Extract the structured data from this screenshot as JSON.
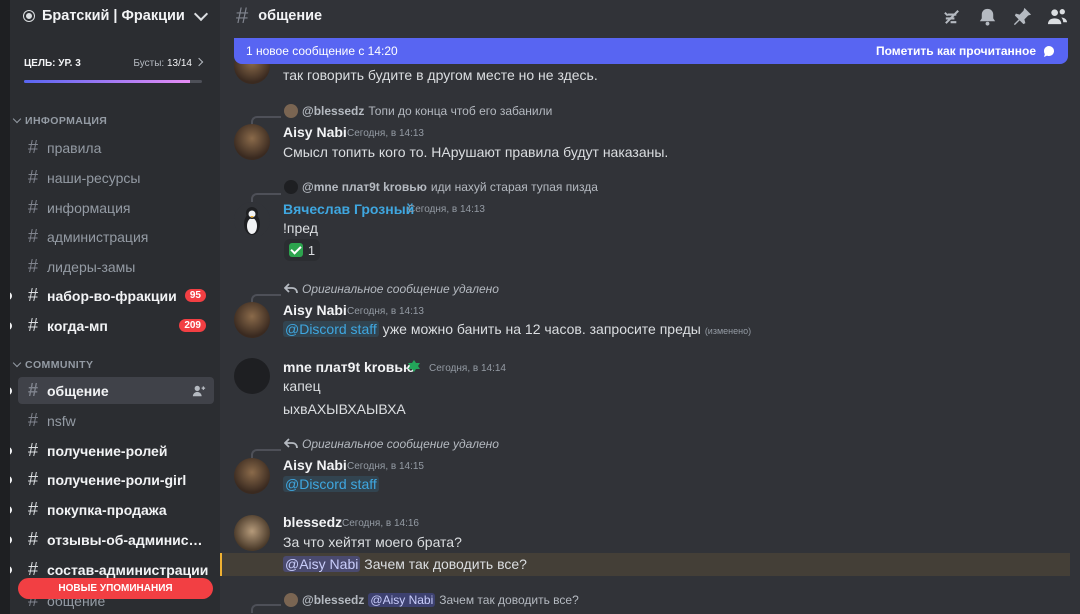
{
  "server": {
    "name": "Братский | Фракции"
  },
  "boost": {
    "goal": "ЦЕЛЬ: УР. 3",
    "label": "Бусты:",
    "count": "13/14",
    "progress": 0.93
  },
  "categories": {
    "info": "ИНФОРМАЦИЯ",
    "community": "COMMUNITY"
  },
  "channels_info": [
    {
      "name": "правила"
    },
    {
      "name": "наши-ресурсы"
    },
    {
      "name": "информация"
    },
    {
      "name": "администрация"
    },
    {
      "name": "лидеры-замы"
    },
    {
      "name": "набор-во-фракции",
      "badge": "95"
    },
    {
      "name": "когда-мп",
      "badge": "209"
    }
  ],
  "channels_community": [
    {
      "name": "общение"
    },
    {
      "name": "nsfw"
    },
    {
      "name": "получение-ролей"
    },
    {
      "name": "получение-роли-girl"
    },
    {
      "name": "покупка-продажа"
    },
    {
      "name": "отзывы-об-администра..."
    },
    {
      "name": "состав-администрации"
    },
    {
      "name": "общение"
    }
  ],
  "mentions_pill": "НОВЫЕ УПОМИНАНИЯ",
  "header": {
    "channel": "общение"
  },
  "newbar": {
    "text": "1 новое сообщение с 14:20",
    "action": "Пометить как прочитанное"
  },
  "messages": {
    "m0": {
      "text": "так говорить будите в другом месте но не здесь."
    },
    "m1": {
      "reply_name": "@blessedz",
      "reply_text": "Топи до конца чтоб его забанили",
      "author": "Aisy Nabi",
      "time": "Сегодня, в 14:13",
      "text": "Смысл топить кого то. НАрушают правила будут наказаны."
    },
    "m2": {
      "reply_name": "@mne плат9t kr",
      "reply_name2": "овью",
      "reply_text": "иди нахуй старая тупая пизда",
      "author": "Вячеслав Грозный",
      "time": "Сегодня, в 14:13",
      "text": "!пред",
      "reaction_count": "1"
    },
    "m3": {
      "reply_deleted": "Оригинальное сообщение удалено",
      "author": "Aisy Nabi",
      "time": "Сегодня, в 14:13",
      "mention": "@Discord staff",
      "text": "уже можно банить на 12 часов. запросите преды",
      "edited": "(изменено)"
    },
    "m4": {
      "author": "mne плат9t kr",
      "author2": "овью",
      "time": "Сегодня, в 14:14",
      "line1": "капец",
      "line2": "ыхвАХЫВХАЫВХА"
    },
    "m5": {
      "reply_deleted": "Оригинальное сообщение удалено",
      "author": "Aisy Nabi",
      "time": "Сегодня, в 14:15",
      "mention": "@Discord staff"
    },
    "m6": {
      "author": "blessedz",
      "time": "Сегодня, в 14:16",
      "line1": "За что хейтят моего брата?",
      "mention": "@Aisy Nabi",
      "line2": "Зачем так доводить все?"
    },
    "m7": {
      "reply_name": "@blessedz",
      "reply_mention": "@Aisy Nabi",
      "reply_text": "Зачем так доводить все?"
    }
  },
  "colors": {
    "accent": "#5865f2",
    "mention_badge": "#f23f43",
    "staff_name": "#3fa7e0",
    "highlight": "#f0b132"
  }
}
